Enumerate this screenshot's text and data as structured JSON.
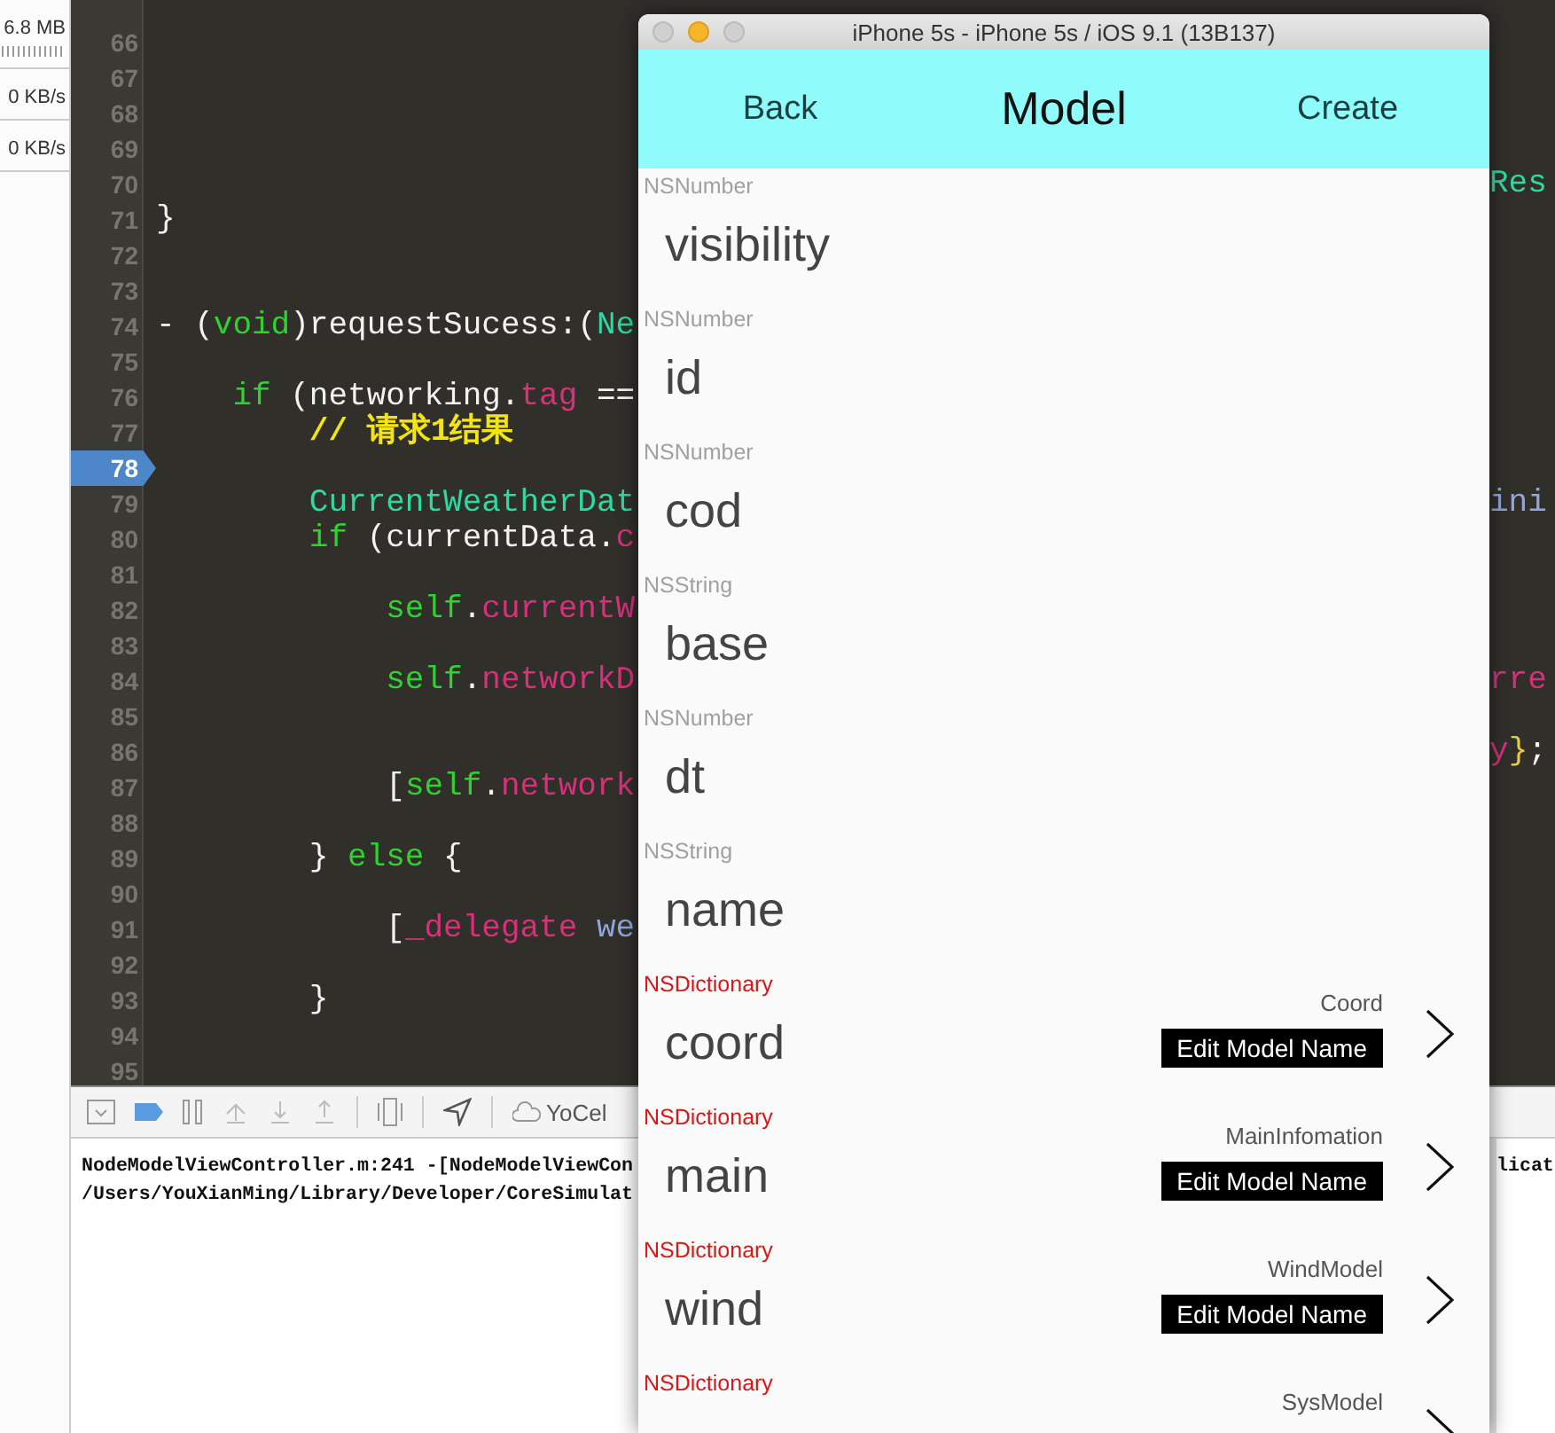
{
  "sidebar": {
    "readings": [
      {
        "text": "6.8 MB",
        "kind": "memory"
      },
      {
        "text": "0 KB/s",
        "kind": "network"
      },
      {
        "text": "0 KB/s",
        "kind": "network"
      }
    ]
  },
  "editor": {
    "lines": [
      {
        "number": "66",
        "breakpoint": false
      },
      {
        "number": "67",
        "breakpoint": false
      },
      {
        "number": "68",
        "breakpoint": false
      },
      {
        "number": "69",
        "breakpoint": false
      },
      {
        "number": "70",
        "breakpoint": false,
        "right": [
          {
            "text": "Res",
            "kind": "type"
          }
        ]
      },
      {
        "number": "71",
        "breakpoint": false,
        "left": [
          {
            "text": "}",
            "kind": "plain"
          }
        ]
      },
      {
        "number": "72",
        "breakpoint": false
      },
      {
        "number": "73",
        "breakpoint": false
      },
      {
        "number": "74",
        "breakpoint": false,
        "left": [
          {
            "text": "- (",
            "kind": "plain"
          },
          {
            "text": "void",
            "kind": "keyword"
          },
          {
            "text": ")requestSucess:(",
            "kind": "plain"
          },
          {
            "text": "Ne",
            "kind": "type"
          }
        ]
      },
      {
        "number": "75",
        "breakpoint": false
      },
      {
        "number": "76",
        "breakpoint": false,
        "left": [
          {
            "text": "    if",
            "kind": "keyword"
          },
          {
            "text": " (networking.",
            "kind": "plain"
          },
          {
            "text": "tag",
            "kind": "property"
          },
          {
            "text": " ==",
            "kind": "plain"
          }
        ]
      },
      {
        "number": "77",
        "breakpoint": false,
        "left": [
          {
            "text": "        // 请求1结果",
            "kind": "comment"
          }
        ]
      },
      {
        "number": "78",
        "breakpoint": true
      },
      {
        "number": "79",
        "breakpoint": false,
        "left": [
          {
            "text": "        CurrentWeatherDat",
            "kind": "type"
          }
        ],
        "right": [
          {
            "text": "ini",
            "kind": "method"
          }
        ]
      },
      {
        "number": "80",
        "breakpoint": false,
        "left": [
          {
            "text": "        if",
            "kind": "keyword"
          },
          {
            "text": " (currentData.",
            "kind": "plain"
          },
          {
            "text": "c",
            "kind": "property"
          }
        ]
      },
      {
        "number": "81",
        "breakpoint": false
      },
      {
        "number": "82",
        "breakpoint": false,
        "left": [
          {
            "text": "            self",
            "kind": "keyword"
          },
          {
            "text": ".",
            "kind": "plain"
          },
          {
            "text": "currentW",
            "kind": "property"
          }
        ]
      },
      {
        "number": "83",
        "breakpoint": false
      },
      {
        "number": "84",
        "breakpoint": false,
        "left": [
          {
            "text": "            self",
            "kind": "keyword"
          },
          {
            "text": ".",
            "kind": "plain"
          },
          {
            "text": "networkD",
            "kind": "property"
          }
        ],
        "right": [
          {
            "text": "rre",
            "kind": "property"
          }
        ]
      },
      {
        "number": "85",
        "breakpoint": false
      },
      {
        "number": "86",
        "breakpoint": false,
        "right": [
          {
            "text": "y",
            "kind": "property"
          },
          {
            "text": "}",
            "kind": "bracket"
          },
          {
            "text": ";",
            "kind": "plain"
          }
        ]
      },
      {
        "number": "87",
        "breakpoint": false,
        "left": [
          {
            "text": "            [",
            "kind": "plain"
          },
          {
            "text": "self",
            "kind": "keyword"
          },
          {
            "text": ".",
            "kind": "plain"
          },
          {
            "text": "network",
            "kind": "property"
          }
        ]
      },
      {
        "number": "88",
        "breakpoint": false
      },
      {
        "number": "89",
        "breakpoint": false,
        "left": [
          {
            "text": "        } ",
            "kind": "plain"
          },
          {
            "text": "else",
            "kind": "keyword"
          },
          {
            "text": " {",
            "kind": "plain"
          }
        ]
      },
      {
        "number": "90",
        "breakpoint": false
      },
      {
        "number": "91",
        "breakpoint": false,
        "left": [
          {
            "text": "            [",
            "kind": "plain"
          },
          {
            "text": "_delegate",
            "kind": "property"
          },
          {
            "text": " we",
            "kind": "method"
          }
        ]
      },
      {
        "number": "92",
        "breakpoint": false
      },
      {
        "number": "93",
        "breakpoint": false,
        "left": [
          {
            "text": "        }",
            "kind": "plain"
          }
        ]
      },
      {
        "number": "94",
        "breakpoint": false
      },
      {
        "number": "95",
        "breakpoint": false
      }
    ]
  },
  "debug": {
    "breakpoints_active": true,
    "scheme": "YoCel",
    "console": [
      {
        "left": "NodeModelViewController.m:241 -[NodeModelViewCon",
        "right": "licat"
      },
      {
        "left": "/Users/YouXianMing/Library/Developer/CoreSimulat"
      }
    ]
  },
  "simulator": {
    "title": "iPhone 5s - iPhone 5s / iOS 9.1 (13B137)",
    "nav": {
      "back": "Back",
      "title": "Model",
      "action": "Create"
    },
    "rows": [
      {
        "kind": "value",
        "type": "NSNumber",
        "name": "visibility"
      },
      {
        "kind": "value",
        "type": "NSNumber",
        "name": "id"
      },
      {
        "kind": "value",
        "type": "NSNumber",
        "name": "cod"
      },
      {
        "kind": "value",
        "type": "NSString",
        "name": "base"
      },
      {
        "kind": "value",
        "type": "NSNumber",
        "name": "dt"
      },
      {
        "kind": "value",
        "type": "NSString",
        "name": "name"
      },
      {
        "kind": "dictionary",
        "type": "NSDictionary",
        "name": "coord",
        "model": "Coord",
        "edit": "Edit Model Name"
      },
      {
        "kind": "dictionary",
        "type": "NSDictionary",
        "name": "main",
        "model": "MainInfomation",
        "edit": "Edit Model Name"
      },
      {
        "kind": "dictionary",
        "type": "NSDictionary",
        "name": "wind",
        "model": "WindModel",
        "edit": "Edit Model Name"
      },
      {
        "kind": "dictionary",
        "type": "NSDictionary",
        "model": "SysModel"
      }
    ]
  }
}
